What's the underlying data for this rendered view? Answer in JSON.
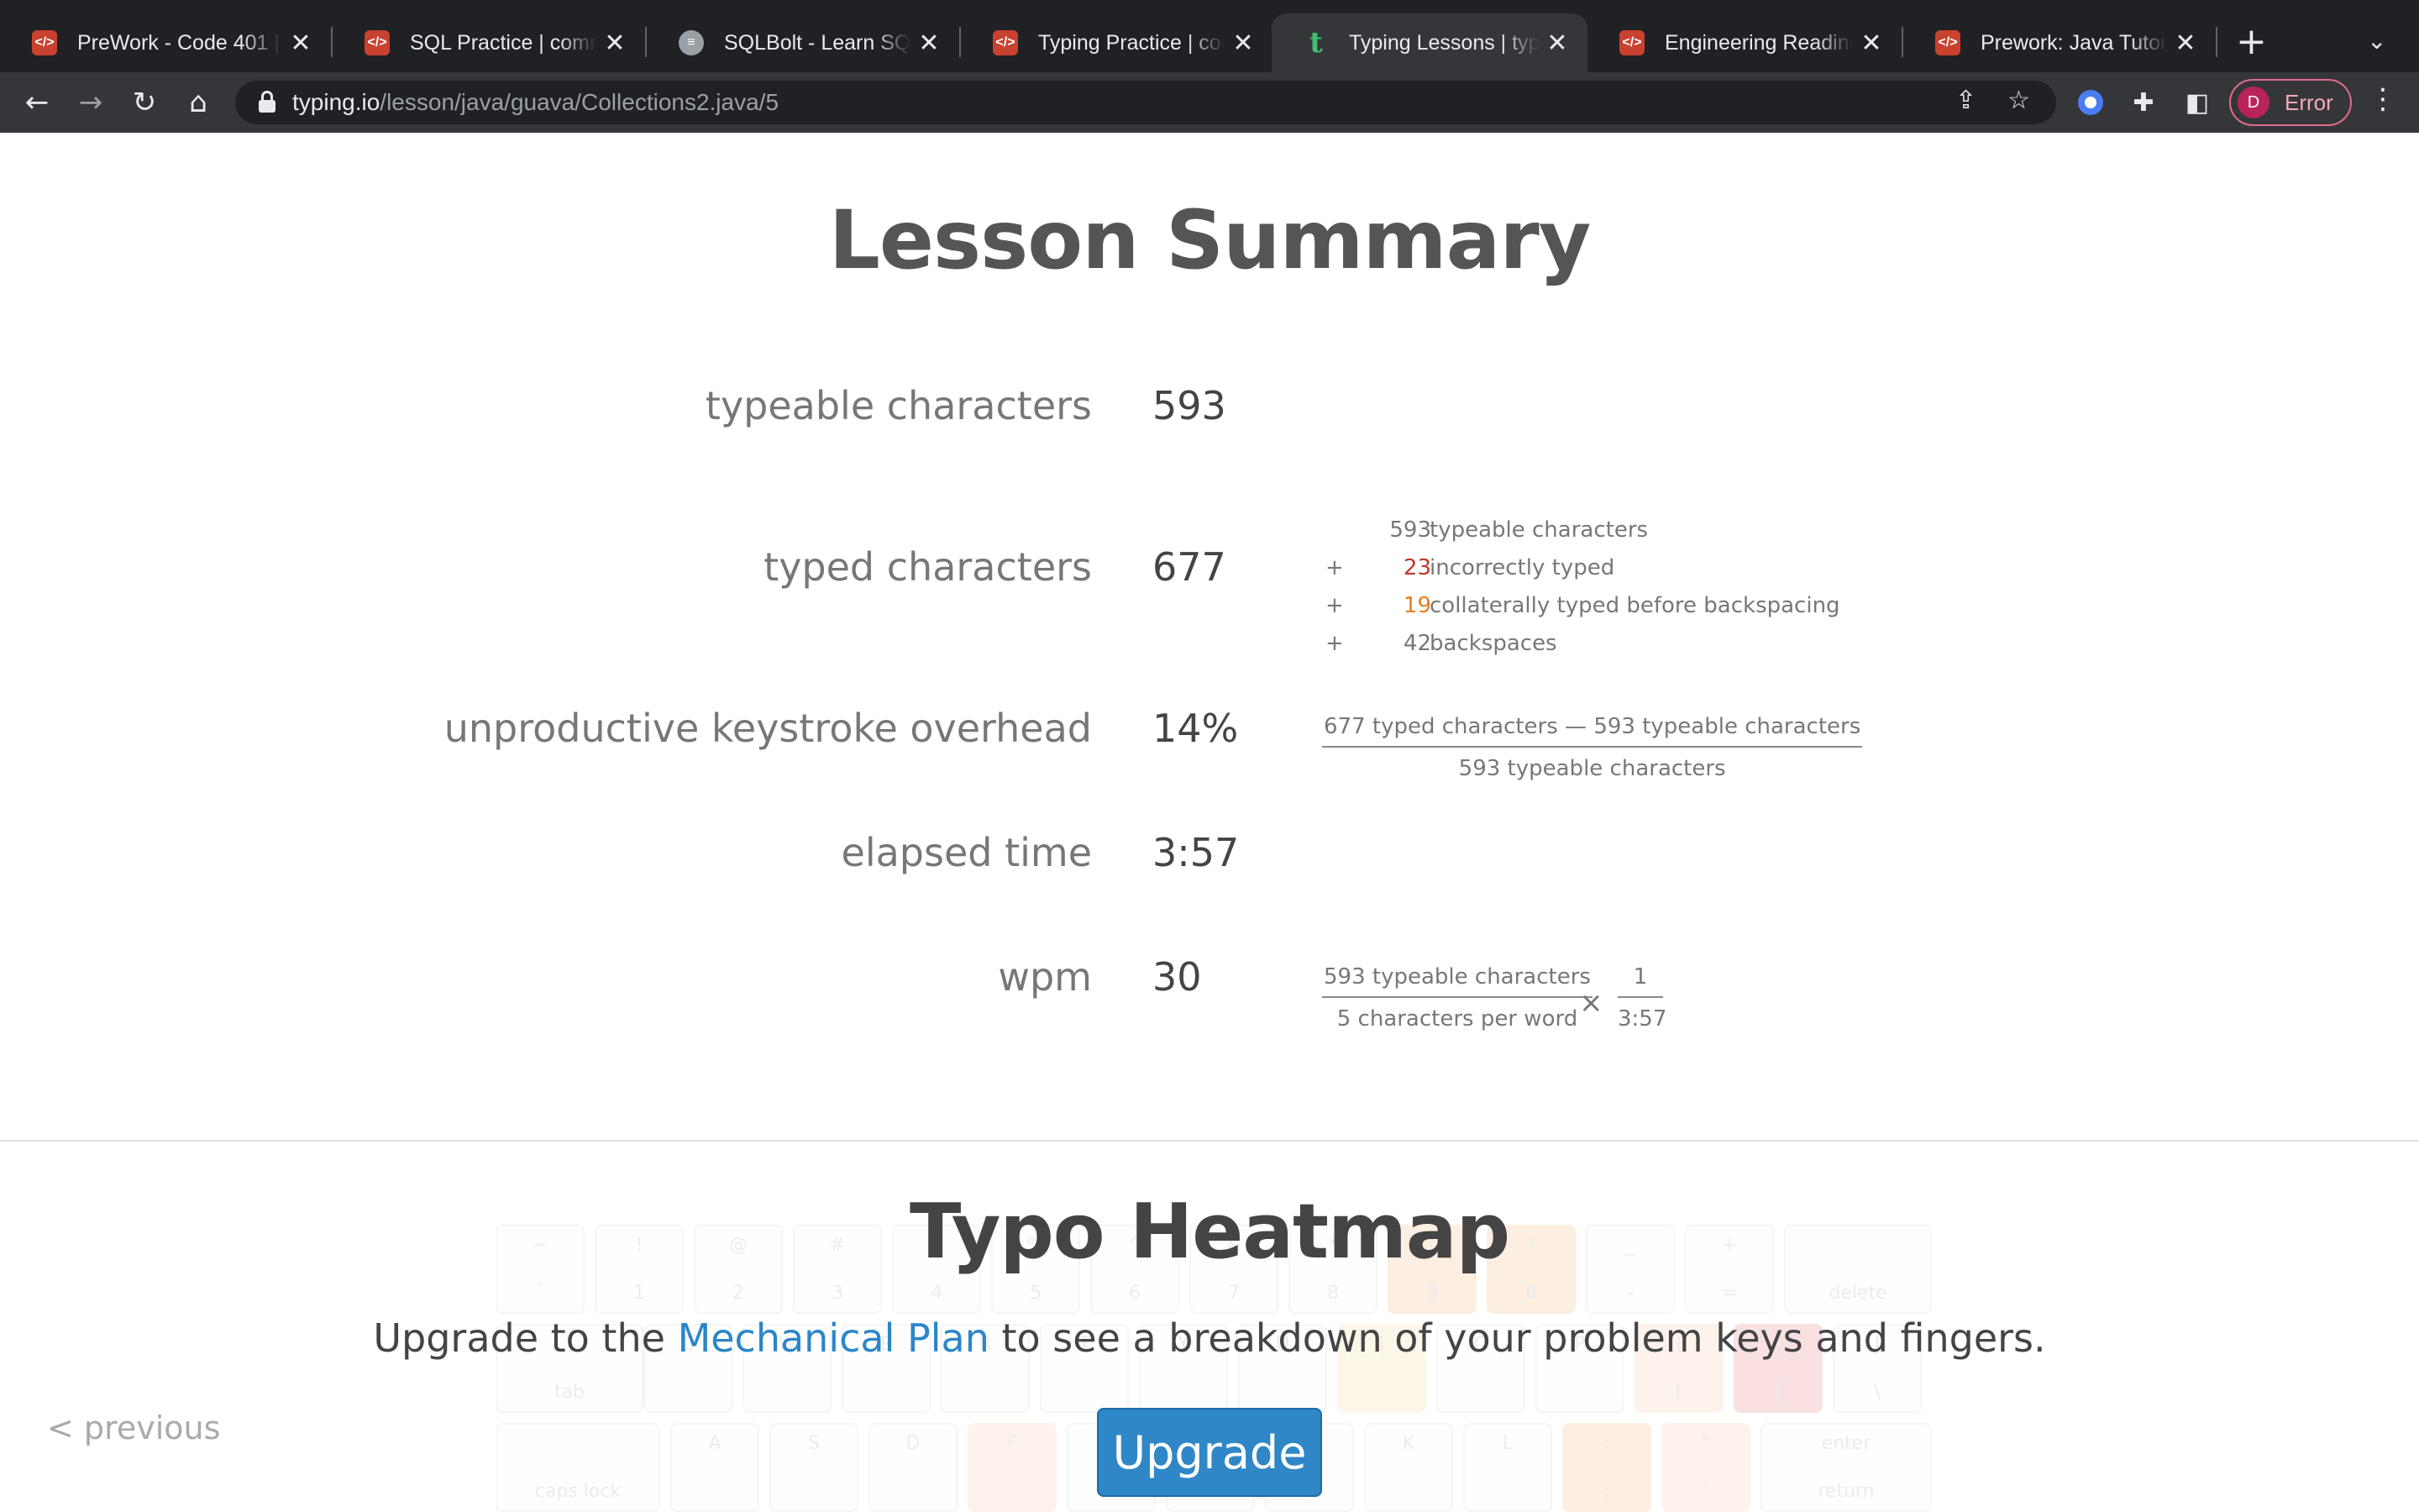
{
  "browser": {
    "tabs": [
      {
        "title": "PreWork - Code 401 |",
        "favicon": "code-fellows-icon"
      },
      {
        "title": "SQL Practice | comm",
        "favicon": "code-fellows-icon"
      },
      {
        "title": "SQLBolt - Learn SQL",
        "favicon": "database-icon"
      },
      {
        "title": "Typing Practice | com",
        "favicon": "code-fellows-icon"
      },
      {
        "title": "Typing Lessons | typi",
        "favicon": "typing-io-icon",
        "active": true
      },
      {
        "title": "Engineering Readings",
        "favicon": "code-fellows-icon"
      },
      {
        "title": "Prework: Java Tutoria",
        "favicon": "code-fellows-icon"
      }
    ],
    "close_glyph": "✕",
    "new_tab_glyph": "+",
    "url_host": "typing.io",
    "url_path": "/lesson/java/guava/Collections2.java/5",
    "profile_initial": "D",
    "profile_label": "Error"
  },
  "summary": {
    "title": "Lesson Summary",
    "stats": {
      "typeable_label": "typeable characters",
      "typeable_value": "593",
      "typed_label": "typed characters",
      "typed_value": "677",
      "overhead_label": "unproductive keystroke overhead",
      "overhead_value": "14%",
      "elapsed_label": "elapsed time",
      "elapsed_value": "3:57",
      "wpm_label": "wpm",
      "wpm_value": "30"
    },
    "breakdown": [
      {
        "plus": "",
        "num": "593",
        "text": "typeable characters"
      },
      {
        "plus": "+",
        "num": "23",
        "text": "incorrectly typed"
      },
      {
        "plus": "+",
        "num": "19",
        "text": "collaterally typed before backspacing"
      },
      {
        "plus": "+",
        "num": "42",
        "text": "backspaces"
      }
    ],
    "overhead_formula": {
      "numerator": "677 typed characters — 593 typeable characters",
      "denominator": "593 typeable characters"
    },
    "wpm_formula": {
      "numerator": "593 typeable characters",
      "denominator": "5 characters per word",
      "times": "×",
      "num2": "1",
      "den2": "3:57"
    }
  },
  "heatmap": {
    "title": "Typo Heatmap",
    "text_before": "Upgrade to the ",
    "link": "Mechanical Plan",
    "text_after": " to see a breakdown of your problem keys and fingers.",
    "button": "Upgrade"
  },
  "nav": {
    "previous": "< previous"
  },
  "colors": {
    "incorrect": "#c0392b",
    "collateral": "#e67e22",
    "link": "#2a86c9",
    "button": "#2f87c7"
  }
}
